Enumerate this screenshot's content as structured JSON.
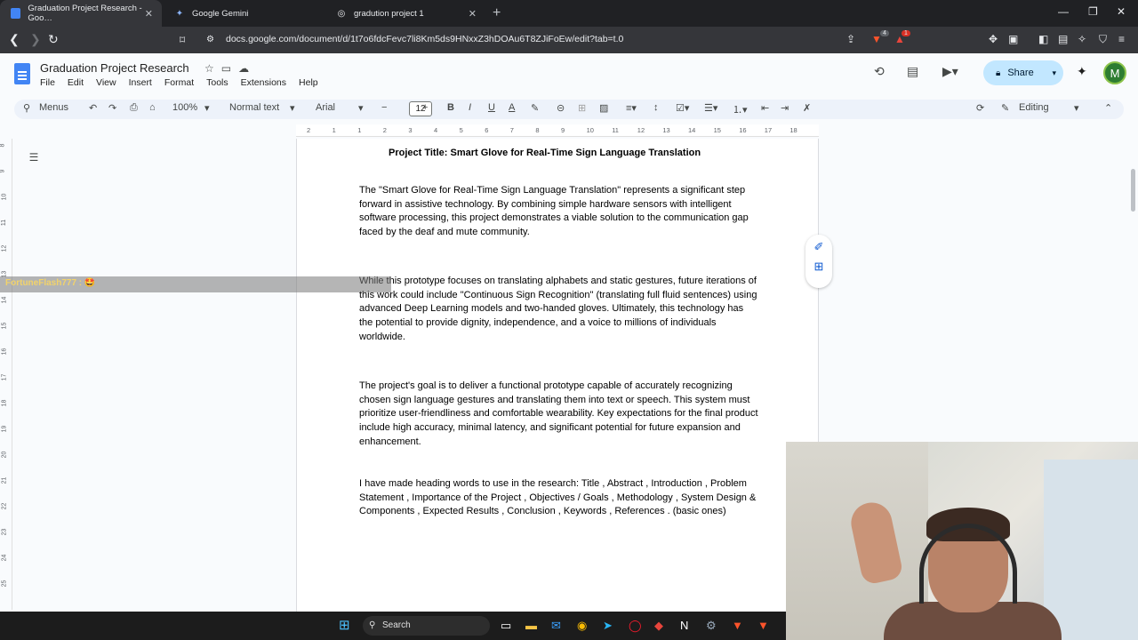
{
  "browser": {
    "tabs": [
      {
        "label": "Graduation Project Research - Goo…",
        "active": true,
        "icon": "docs-icon"
      },
      {
        "label": "Google Gemini",
        "active": false,
        "icon": "gemini-icon"
      },
      {
        "label": "gradution project 1",
        "active": false,
        "icon": "web-icon"
      }
    ],
    "url": "docs.google.com/document/d/1t7o6fdcFevc7li8Km5ds9HNxxZ3hDOAu6T8ZJiFoEw/edit?tab=t.0",
    "ext_badges": {
      "brave": "4",
      "alert": "1"
    }
  },
  "docs": {
    "title": "Graduation Project Research",
    "menu": [
      "File",
      "Edit",
      "View",
      "Insert",
      "Format",
      "Tools",
      "Extensions",
      "Help"
    ],
    "share_label": "Share",
    "avatar_letter": "M",
    "toolbar": {
      "menus_label": "Menus",
      "zoom": "100%",
      "style": "Normal text",
      "font": "Arial",
      "font_size": "12",
      "mode": "Editing"
    },
    "ruler_ticks": [
      "2",
      "1",
      "1",
      "2",
      "3",
      "4",
      "5",
      "6",
      "7",
      "8",
      "9",
      "10",
      "11",
      "12",
      "13",
      "14",
      "15",
      "16",
      "17",
      "18"
    ],
    "vruler_ticks": [
      "8",
      "9",
      "10",
      "11",
      "12",
      "13",
      "14",
      "15",
      "16",
      "17",
      "18",
      "19",
      "20",
      "21",
      "22",
      "23",
      "24",
      "25"
    ]
  },
  "document": {
    "heading": "Project Title: Smart Glove for Real-Time Sign Language Translation",
    "paragraphs": [
      "The \"Smart Glove for Real-Time Sign Language Translation\" represents a significant step forward in assistive technology. By combining simple hardware sensors with intelligent software processing, this project demonstrates a viable solution to the communication gap faced by the deaf and mute community.",
      "While this prototype focuses on translating alphabets and static gestures, future iterations of this work could include \"Continuous Sign Recognition\" (translating full fluid sentences) using advanced Deep Learning models and two-handed gloves. Ultimately, this technology has the potential to provide dignity, independence, and a voice to millions of individuals worldwide.",
      "The project's goal is to deliver a functional prototype capable of accurately recognizing chosen sign language gestures and translating them into text or speech. This system must prioritize user-friendliness and comfortable wearability. Key expectations for the final product include high accuracy, minimal latency, and significant potential for future expansion and enhancement.",
      " I have made heading words to use in the research: Title , Abstract , Introduction , Problem Statement ,  Importance of the Project , Objectives / Goals , Methodology , System Design & Components , Expected Results , Conclusion , Keywords , References . (basic ones)"
    ]
  },
  "overlay": {
    "chat_message": "FortuneFlash777 : 🤩"
  },
  "taskbar": {
    "search_label": "Search"
  }
}
